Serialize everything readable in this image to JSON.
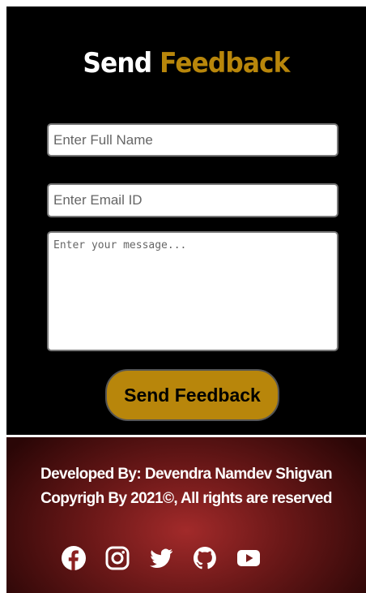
{
  "title": {
    "word1": "Send",
    "word2": "Feedback"
  },
  "form": {
    "name_placeholder": "Enter Full Name",
    "name_value": "",
    "email_placeholder": "Enter Email ID",
    "email_value": "",
    "message_placeholder": "Enter your message...",
    "message_value": "",
    "submit_label": "Send Feedback"
  },
  "footer": {
    "developed_by": "Developed By: Devendra Namdev Shigvan",
    "copyright": "Copyrigh By 2021©, All rights are reserved",
    "social": [
      {
        "icon": "facebook-icon"
      },
      {
        "icon": "instagram-icon"
      },
      {
        "icon": "twitter-icon"
      },
      {
        "icon": "github-icon"
      },
      {
        "icon": "youtube-icon"
      }
    ]
  },
  "colors": {
    "background": "#000000",
    "accent": "#b8860b",
    "footer_red": "#a22a2a",
    "text_light": "#ffffff"
  }
}
